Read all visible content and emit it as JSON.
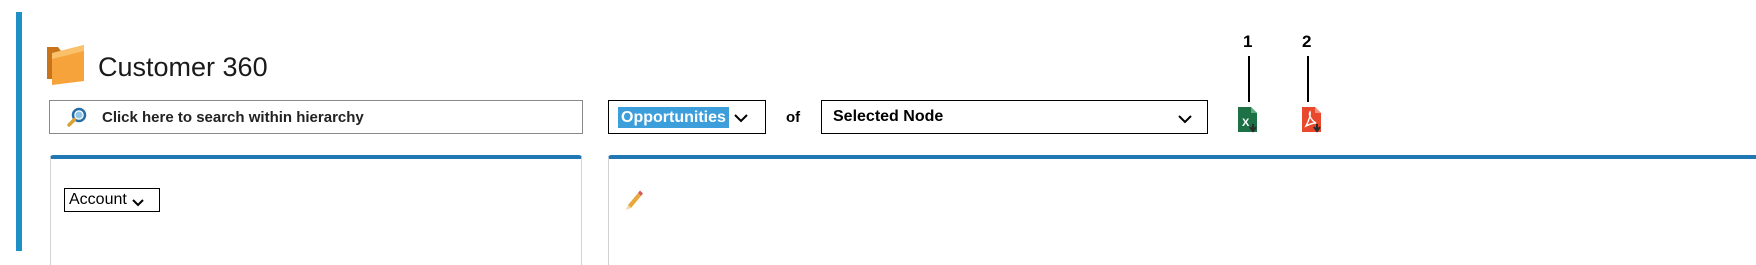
{
  "header": {
    "title": "Customer 360",
    "icon": "folder-icon"
  },
  "search": {
    "placeholder": "Click here to search within hierarchy",
    "icon": "search-icon"
  },
  "object_select": {
    "value": "Opportunities",
    "highlight_color": "#3c9fdc"
  },
  "connector_label": "of",
  "node_select": {
    "value": "Selected Node"
  },
  "annotations": {
    "excel_marker": "1",
    "pdf_marker": "2"
  },
  "export": {
    "excel_icon": "excel-export-icon",
    "pdf_icon": "pdf-export-icon",
    "excel_color": "#1e7145",
    "pdf_color": "#e8492d"
  },
  "left_panel": {
    "type_select": "Account"
  },
  "right_panel": {
    "edit_icon": "pencil-icon"
  },
  "colors": {
    "accent": "#1f8fc6",
    "panel_border": "#1f78b4"
  }
}
